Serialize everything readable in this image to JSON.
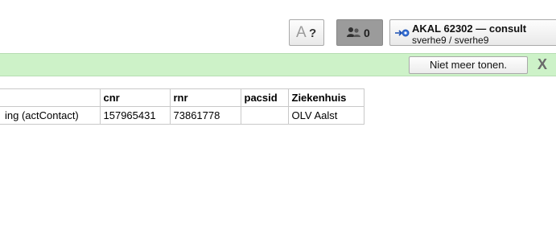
{
  "toolbar": {
    "font_button": {
      "glyph": "A",
      "mark": "?"
    },
    "users_button": {
      "count": "0",
      "icon": "users-icon"
    },
    "context": {
      "title": "AKAL 62302 — consult",
      "subtitle": "sverhe9 / sverhe9",
      "icon": "context-switch-icon"
    }
  },
  "notification": {
    "dismiss_label": "Niet meer tonen.",
    "close_label": "X",
    "background_color": "#cdf2c8"
  },
  "table": {
    "headers": [
      "",
      "cnr",
      "rnr",
      "pacsid",
      "Ziekenhuis"
    ],
    "rows": [
      [
        "ing (actContact)",
        "157965431",
        "73861778",
        "",
        "OLV Aalst"
      ]
    ]
  }
}
